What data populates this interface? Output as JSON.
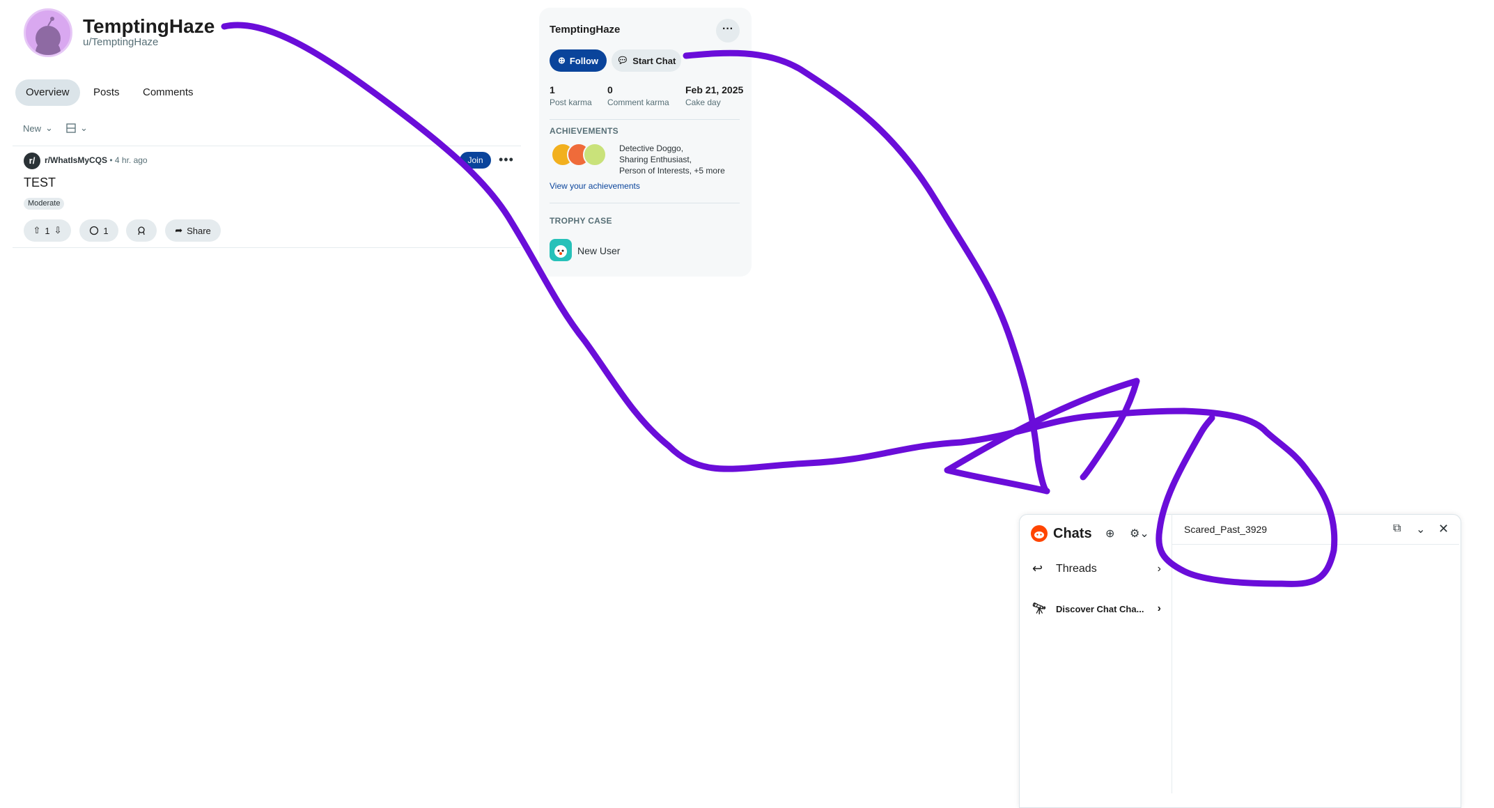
{
  "profile": {
    "display_name": "TemptingHaze",
    "handle": "u/TemptingHaze"
  },
  "tabs": [
    {
      "label": "Overview",
      "active": true
    },
    {
      "label": "Posts",
      "active": false
    },
    {
      "label": "Comments",
      "active": false
    }
  ],
  "sort": {
    "label": "New"
  },
  "post": {
    "subreddit": "r/WhatIsMyCQS",
    "time": "• 4 hr. ago",
    "join_label": "Join",
    "title": "TEST",
    "flair": "Moderate",
    "votes": "1",
    "comments": "1",
    "share_label": "Share"
  },
  "sidebar": {
    "title": "TemptingHaze",
    "more_label": "···",
    "follow_label": "Follow",
    "chat_label": "Start Chat",
    "stats": [
      {
        "value": "1",
        "label": "Post karma"
      },
      {
        "value": "0",
        "label": "Comment karma"
      },
      {
        "value": "Feb 21, 2025",
        "label": "Cake day"
      }
    ],
    "achievements_heading": "ACHIEVEMENTS",
    "achievements_line1": "Detective Doggo,",
    "achievements_line2": "Sharing Enthusiast,",
    "achievements_line3": "Person of Interests, +5 more",
    "achievements_link": "View your achievements",
    "trophy_heading": "TROPHY CASE",
    "trophy_name": "New User"
  },
  "chat": {
    "title": "Chats",
    "threads_label": "Threads",
    "discover_label": "Discover Chat Cha...",
    "active_user": "Scared_Past_3929"
  },
  "colors": {
    "accent_blue": "#0a449b",
    "annotation_purple": "#6a0dd9",
    "reddit_orange": "#ff4500"
  }
}
